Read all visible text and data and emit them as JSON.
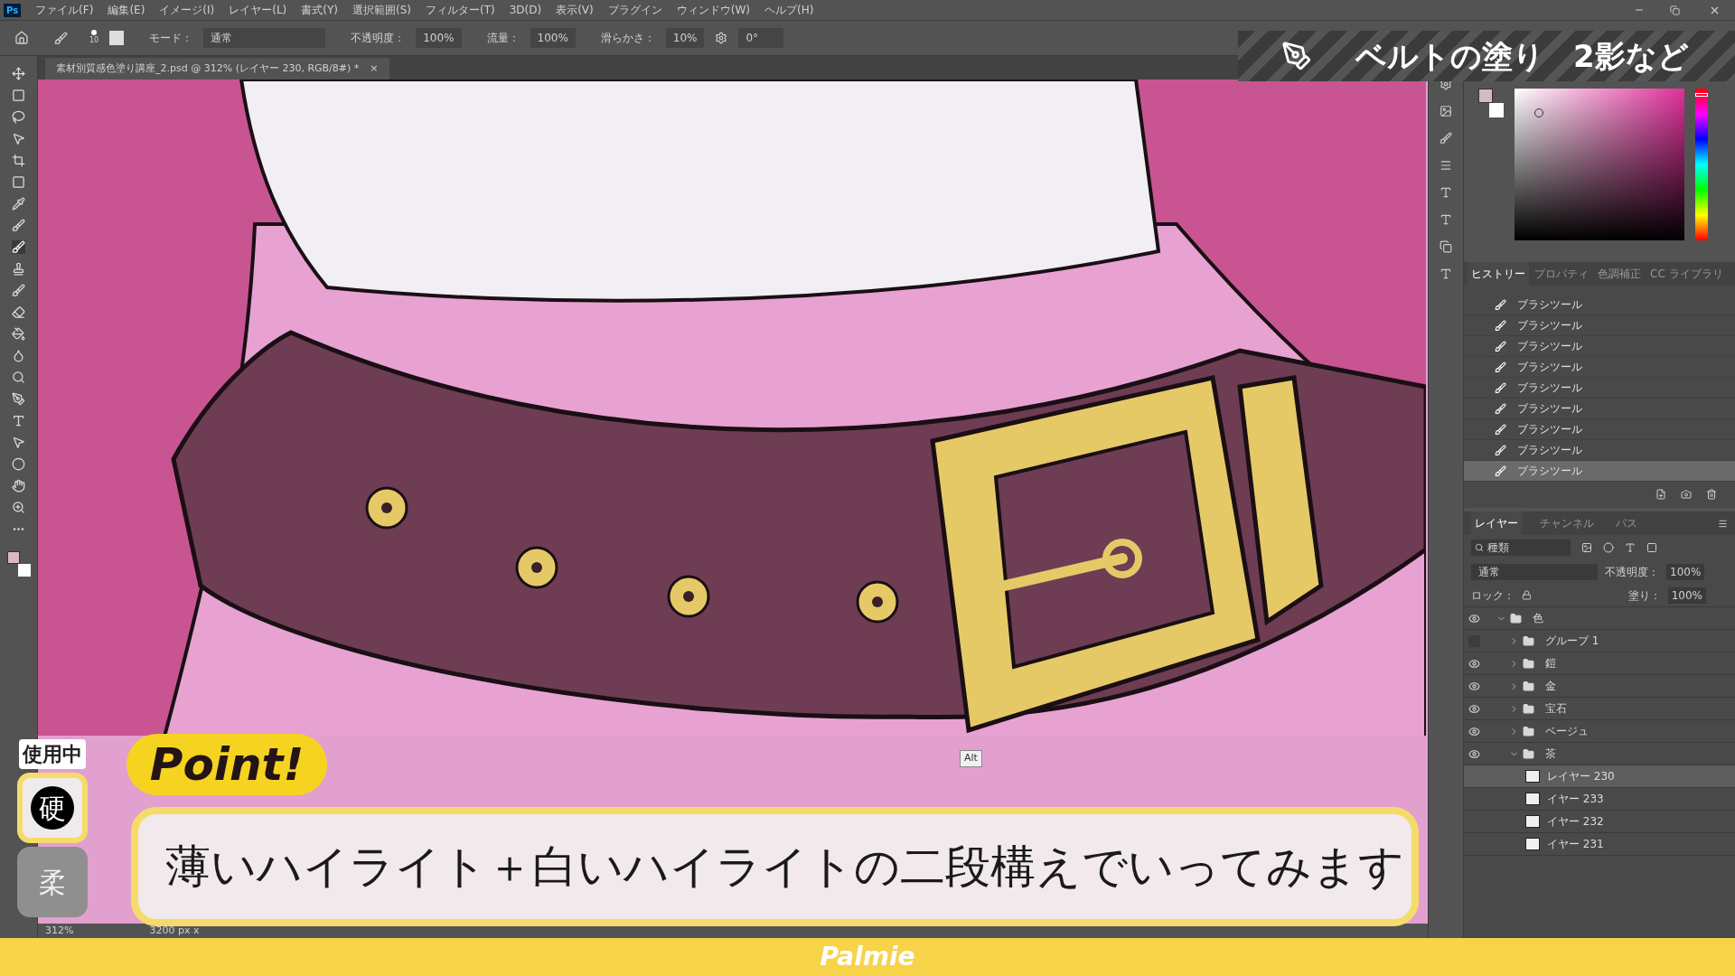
{
  "app_logo": "Ps",
  "menu": [
    "ファイル(F)",
    "編集(E)",
    "イメージ(I)",
    "レイヤー(L)",
    "書式(Y)",
    "選択範囲(S)",
    "フィルター(T)",
    "3D(D)",
    "表示(V)",
    "プラグイン",
    "ウィンドウ(W)",
    "ヘルプ(H)"
  ],
  "options_bar": {
    "brush_size": "10",
    "mode_label": "モード：",
    "mode": "通常",
    "opacity_label": "不透明度：",
    "opacity": "100%",
    "flow_label": "流量：",
    "flow": "100%",
    "smoothing_label": "滑らかさ：",
    "smoothing": "10%",
    "angle": "0°"
  },
  "document_tab": {
    "title": "素材別質感色塗り講座_2.psd @ 312% (レイヤー 230, RGB/8#) *",
    "close": "×"
  },
  "history_panel": {
    "tabs": [
      {
        "label": "ヒストリー",
        "selected": true
      },
      {
        "label": "プロパティ",
        "selected": false
      },
      {
        "label": "色調補正",
        "selected": false
      },
      {
        "label": "CC ライブラリ",
        "selected": false
      }
    ],
    "items": [
      {
        "label": "ブラシツール",
        "selected": false
      },
      {
        "label": "ブラシツール",
        "selected": false
      },
      {
        "label": "ブラシツール",
        "selected": false
      },
      {
        "label": "ブラシツール",
        "selected": false
      },
      {
        "label": "ブラシツール",
        "selected": false
      },
      {
        "label": "ブラシツール",
        "selected": false
      },
      {
        "label": "ブラシツール",
        "selected": false
      },
      {
        "label": "ブラシツール",
        "selected": false
      },
      {
        "label": "ブラシツール",
        "selected": true
      }
    ]
  },
  "layers_panel": {
    "tabs": [
      {
        "label": "レイヤー",
        "selected": true
      },
      {
        "label": "チャンネル",
        "selected": false
      },
      {
        "label": "パス",
        "selected": false
      }
    ],
    "filter": "種類",
    "blend_mode": "通常",
    "opacity_label": "不透明度：",
    "opacity": "100%",
    "lock_label": "ロック：",
    "fill_label": "塗り：",
    "fill": "100%",
    "layers": [
      {
        "kind": "group",
        "name": "色",
        "visible": true,
        "expanded": true,
        "selected": false,
        "children": [
          {
            "kind": "group",
            "name": "グループ 1",
            "visible": false,
            "expanded": false,
            "selected": false
          },
          {
            "kind": "group",
            "name": "鎧",
            "visible": true,
            "expanded": false,
            "selected": false
          },
          {
            "kind": "group",
            "name": "金",
            "visible": true,
            "expanded": false,
            "selected": false
          },
          {
            "kind": "group",
            "name": "宝石",
            "visible": true,
            "expanded": false,
            "selected": false
          },
          {
            "kind": "group",
            "name": "ベージュ",
            "visible": true,
            "expanded": false,
            "selected": false
          },
          {
            "kind": "group",
            "name": "茶",
            "visible": true,
            "expanded": true,
            "selected": false,
            "children": [
              {
                "kind": "layer",
                "name": "レイヤー 230",
                "selected": true
              },
              {
                "kind": "layer",
                "name": "イヤー 233",
                "selected": false
              },
              {
                "kind": "layer",
                "name": "イヤー 232",
                "selected": false
              },
              {
                "kind": "layer",
                "name": "イヤー 231",
                "selected": false
              }
            ]
          }
        ]
      }
    ]
  },
  "color_panel": {
    "hue": {
      "level": 0.97
    }
  },
  "status_bar": {
    "zoom": "312%",
    "size": "3200 px x"
  },
  "overlay": {
    "banner_title": "ベルトの塗り",
    "banner_subtitle": "2影など",
    "point_badge": "Point!",
    "caption": "薄いハイライト＋白いハイライトの二段構えでいってみます",
    "brush_label": "使用中",
    "brush_modes": [
      {
        "label": "硬",
        "selected": true
      },
      {
        "label": "柔",
        "selected": false
      }
    ],
    "modifier_tooltip": "Alt"
  },
  "footer": {
    "logo": "Palmie"
  }
}
